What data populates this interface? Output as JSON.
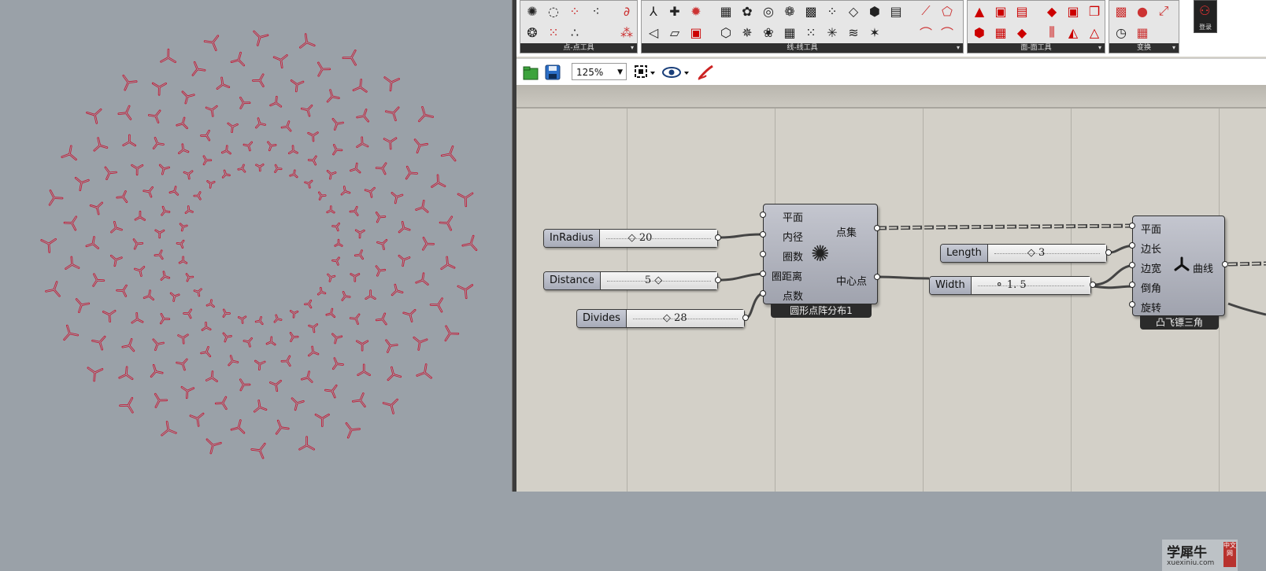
{
  "ribbon": {
    "panels": [
      {
        "label": "点-点工具"
      },
      {
        "label": "线-线工具"
      },
      {
        "label": "面-面工具"
      },
      {
        "label": "变换"
      }
    ],
    "user_button_label": "登录"
  },
  "toolbar": {
    "zoom": "125%"
  },
  "components": {
    "sliders": {
      "inradius": {
        "name": "InRadius",
        "value": "20"
      },
      "distance": {
        "name": "Distance",
        "value": "5"
      },
      "divides": {
        "name": "Divides",
        "value": "28"
      },
      "length": {
        "name": "Length",
        "value": "3"
      },
      "width": {
        "name": "Width",
        "value": "1. 5"
      }
    },
    "circle_array": {
      "title": "圆形点阵分布1",
      "inputs": [
        "平面",
        "内径",
        "圈数",
        "圈距离",
        "点数"
      ],
      "outputs": [
        "点集",
        "中心点"
      ]
    },
    "tri_shape": {
      "title": "凸飞镖三角",
      "inputs": [
        "平面",
        "边长",
        "边宽",
        "倒角",
        "旋转"
      ],
      "outputs": [
        "曲线"
      ]
    }
  },
  "watermark": {
    "brand": "学犀牛",
    "url": "xuexiniu.com",
    "tag": "中文网"
  },
  "colors": {
    "viewport_bg": "#9aa1a8",
    "curve": "#c8102e",
    "canvas_bg": "#d3d0c8"
  }
}
